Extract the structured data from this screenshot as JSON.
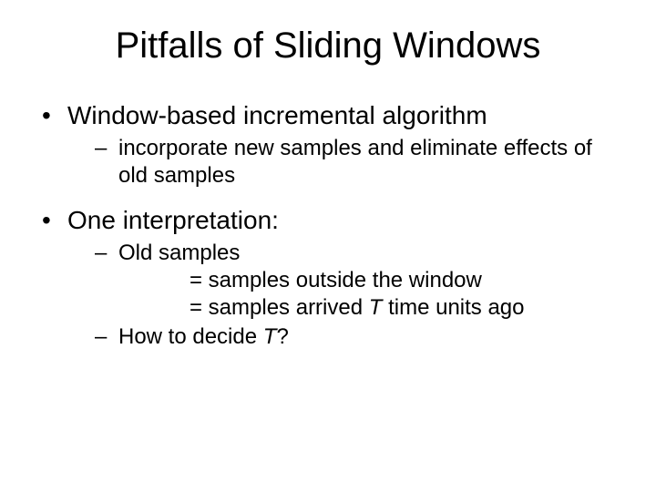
{
  "title": "Pitfalls of Sliding Windows",
  "bullets": [
    {
      "text": "Window-based incremental algorithm",
      "sub": [
        {
          "text": "incorporate new samples and eliminate effects of old samples"
        }
      ]
    },
    {
      "text": "One interpretation:",
      "sub": [
        {
          "text": "Old samples",
          "cont": [
            "= samples outside the window",
            {
              "pre": "= samples arrived ",
              "ital": "T",
              "post": " time units ago"
            }
          ]
        },
        {
          "pre": "How to decide ",
          "ital": "T",
          "post": "?"
        }
      ]
    }
  ]
}
